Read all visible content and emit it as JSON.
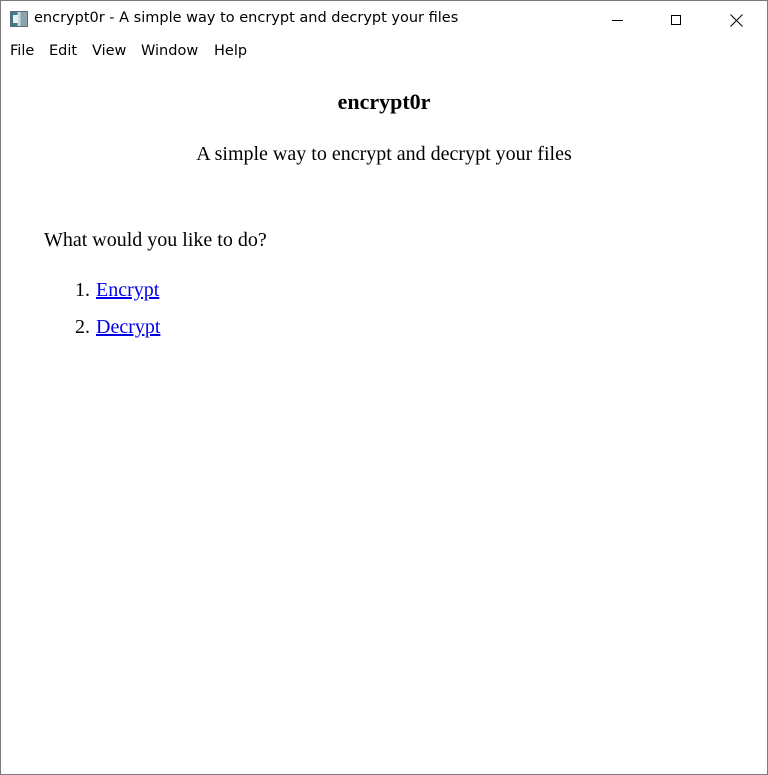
{
  "window": {
    "title": "encrypt0r - A simple way to encrypt and decrypt your files",
    "icon": "app-icon"
  },
  "menu": {
    "items": [
      "File",
      "Edit",
      "View",
      "Window",
      "Help"
    ]
  },
  "content": {
    "title": "encrypt0r",
    "subtitle": "A simple way to encrypt and decrypt your files",
    "prompt": "What would you like to do?",
    "options": [
      {
        "number": "1.",
        "label": "Encrypt"
      },
      {
        "number": "2.",
        "label": "Decrypt"
      }
    ]
  },
  "colors": {
    "link": "#0000ee",
    "background": "#ffffff",
    "text": "#000000"
  }
}
